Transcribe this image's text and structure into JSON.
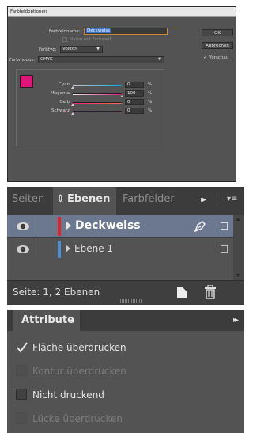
{
  "swatch_dialog": {
    "title": "Farbfeldoptionen",
    "name_label": "Farbfeldname:",
    "name_value": "Deckweiss",
    "name_with_value_label": "Name mit Farbwert",
    "type_label": "Farbtyp:",
    "type_value": "Vollton",
    "mode_label": "Farbmodus:",
    "mode_value": "CMYK",
    "swatch_color": "#e0157a",
    "sliders": [
      {
        "label": "Cyan",
        "value": "0",
        "unit": "%",
        "fraction": 0.0,
        "gradient": [
          "#c8c8c8",
          "#00a3e0"
        ]
      },
      {
        "label": "Magenta",
        "value": "100",
        "unit": "%",
        "fraction": 1.0,
        "gradient": [
          "#e8e8e8",
          "#e0157a"
        ]
      },
      {
        "label": "Gelb",
        "value": "0",
        "unit": "%",
        "fraction": 0.0,
        "gradient": [
          "#e8207f",
          "#f07040"
        ]
      },
      {
        "label": "Schwarz",
        "value": "0",
        "unit": "%",
        "fraction": 0.0,
        "gradient": [
          "#e0157a",
          "#300018"
        ]
      }
    ],
    "ok_label": "OK",
    "cancel_label": "Abbrechen",
    "preview_check": "✓",
    "preview_label": "Vorschau"
  },
  "layers_panel": {
    "tabs": [
      {
        "label": "Seiten"
      },
      {
        "label": "Ebenen",
        "active": true
      },
      {
        "label": "Farbfelder"
      }
    ],
    "tab_swap_icon": "⇕",
    "overflow_icon": "▸▸",
    "menu_icon": "▾≡",
    "layers": [
      {
        "name": "Deckweiss",
        "visible": true,
        "color": "#e8202a",
        "selected": true
      },
      {
        "name": "Ebene 1",
        "visible": true,
        "color": "#4a90d9",
        "selected": false
      }
    ],
    "status": "Seite: 1, 2 Ebenen"
  },
  "attributes_panel": {
    "tab_label": "Attribute",
    "overflow_icon": "▸▸",
    "options": [
      {
        "label": "Fläche überdrucken",
        "checked": true,
        "enabled": true
      },
      {
        "label": "Kontur überdrucken",
        "checked": false,
        "enabled": false
      },
      {
        "label": "Nicht druckend",
        "checked": false,
        "enabled": true
      },
      {
        "label": "Lücke überdrucken",
        "checked": false,
        "enabled": false
      }
    ]
  }
}
